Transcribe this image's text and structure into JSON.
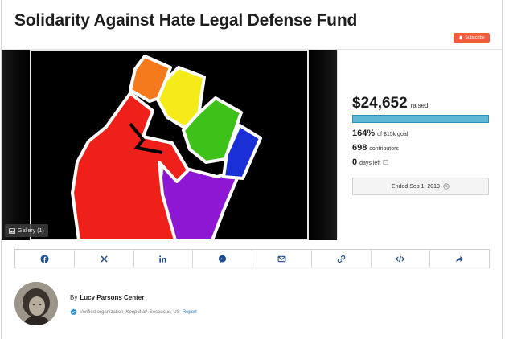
{
  "campaign": {
    "title": "Solidarity Against Hate Legal Defense Fund"
  },
  "header": {
    "subscribe_label": "Subscribe"
  },
  "media": {
    "gallery_label": "Gallery (1)"
  },
  "stats": {
    "raised_amount": "$24,652",
    "raised_label": "raised",
    "progress_fraction": 1.0,
    "goal_percent": "164%",
    "goal_text": "of $15k goal",
    "contributors_count": "698",
    "contributors_label": "contributors",
    "days_count": "0",
    "days_label": "days left",
    "ended_text": "Ended Sep 1, 2019"
  },
  "share": {
    "items": [
      "facebook-icon",
      "x-icon",
      "linkedin-icon",
      "messenger-icon",
      "email-icon",
      "link-icon",
      "embed-icon",
      "share-arrow-icon"
    ]
  },
  "organizer": {
    "by_prefix": "By",
    "name": "Lucy Parsons Center",
    "verified_label": "Verified organization",
    "keep_label": "Keep it all",
    "location": "Secaucus, US",
    "report_label": "Report"
  },
  "colors": {
    "accent_subscribe": "#f25c3d",
    "progress_fill": "#5fb7d6",
    "share_icon": "#1f4e8f"
  }
}
